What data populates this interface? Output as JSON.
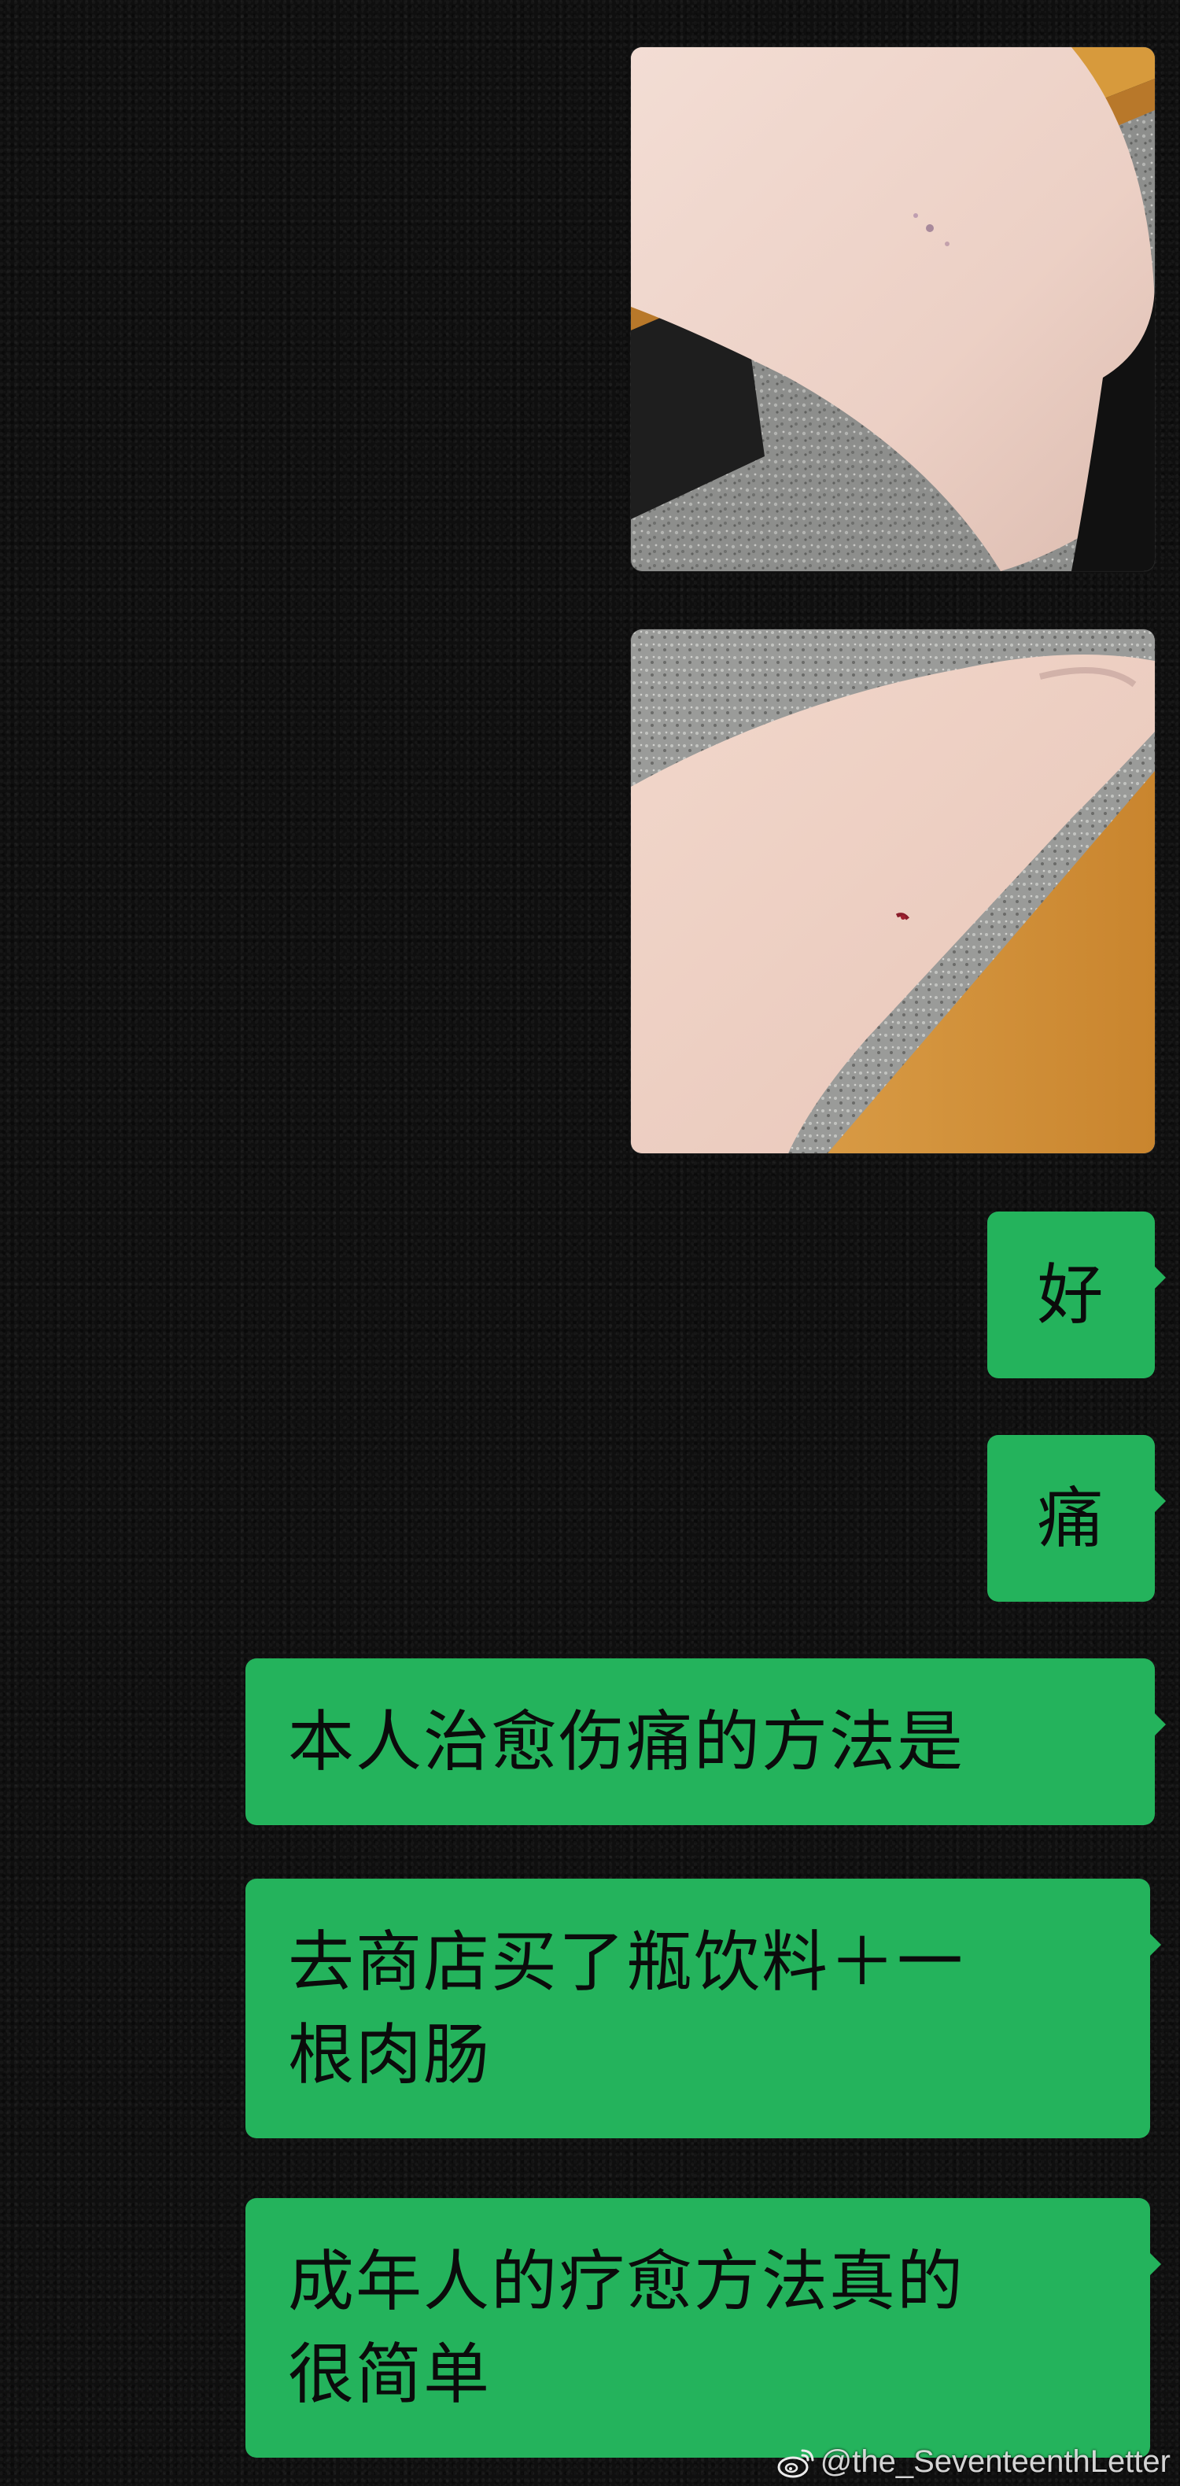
{
  "messages": [
    {
      "type": "image",
      "side": "right",
      "icon": "photo-forearm-on-bench"
    },
    {
      "type": "image",
      "side": "right",
      "icon": "photo-forearm-scratch"
    },
    {
      "type": "text",
      "side": "right",
      "text": "好"
    },
    {
      "type": "text",
      "side": "right",
      "text": "痛"
    },
    {
      "type": "text",
      "side": "right",
      "text": "本人治愈伤痛的方法是"
    },
    {
      "type": "text",
      "side": "right",
      "lines": [
        "去商店买了瓶饮料＋一",
        "根肉肠"
      ]
    },
    {
      "type": "text",
      "side": "right",
      "lines": [
        "成年人的疗愈方法真的",
        "很简单"
      ]
    }
  ],
  "watermark": {
    "text": "@the_SeventeenthLetter",
    "icon": "weibo-logo-icon"
  },
  "colors": {
    "background": "#0f0f0f",
    "bubble": "#24b35c",
    "bubble_text": "#0b0b0b"
  }
}
